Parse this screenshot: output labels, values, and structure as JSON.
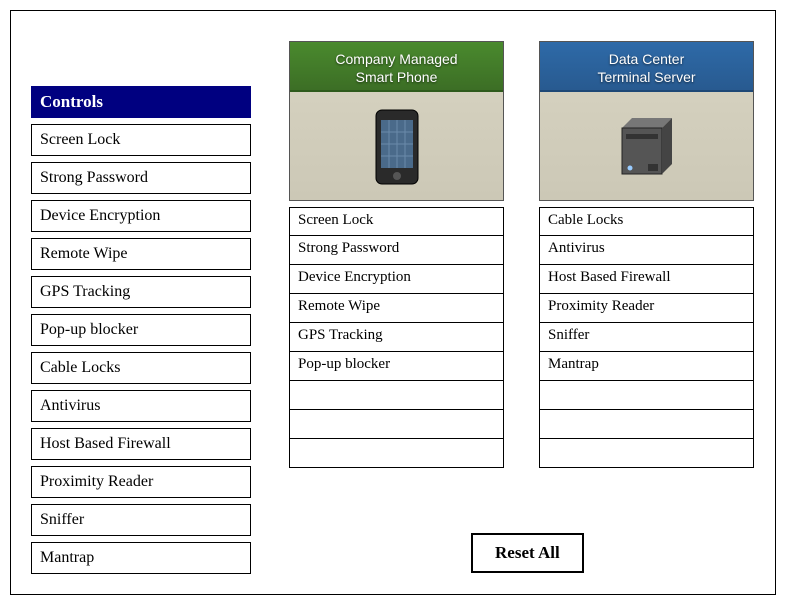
{
  "controls_header": "Controls",
  "controls": [
    "Screen Lock",
    "Strong Password",
    "Device Encryption",
    "Remote Wipe",
    "GPS Tracking",
    "Pop-up blocker",
    "Cable Locks",
    "Antivirus",
    "Host Based Firewall",
    "Proximity Reader",
    "Sniffer",
    "Mantrap"
  ],
  "phone": {
    "title_line1": "Company Managed",
    "title_line2": "Smart Phone",
    "slots": [
      "Screen Lock",
      "Strong Password",
      "Device Encryption",
      "Remote Wipe",
      "GPS Tracking",
      "Pop-up blocker",
      "",
      "",
      ""
    ]
  },
  "server": {
    "title_line1": "Data Center",
    "title_line2": "Terminal Server",
    "slots": [
      "Cable Locks",
      "Antivirus",
      "Host Based Firewall",
      "Proximity Reader",
      "Sniffer",
      "Mantrap",
      "",
      "",
      ""
    ]
  },
  "reset_label": "Reset All"
}
